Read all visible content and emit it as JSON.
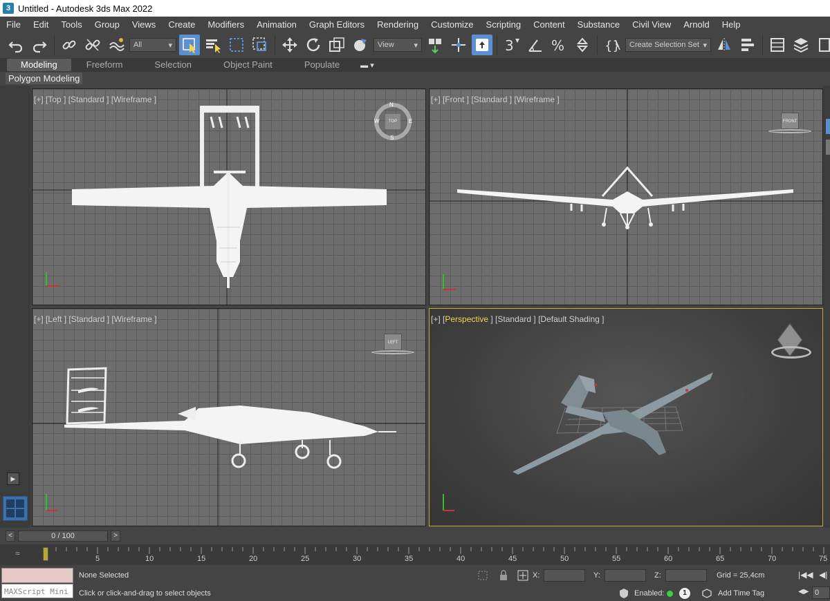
{
  "window": {
    "title": "Untitled - Autodesk 3ds Max 2022",
    "app_icon_text": "3"
  },
  "menu": [
    "File",
    "Edit",
    "Tools",
    "Group",
    "Views",
    "Create",
    "Modifiers",
    "Animation",
    "Graph Editors",
    "Rendering",
    "Customize",
    "Scripting",
    "Content",
    "Substance",
    "Civil View",
    "Arnold",
    "Help"
  ],
  "toolbar": {
    "filter_value": "All",
    "refcoord_value": "View",
    "selection_set_placeholder": "Create Selection Set",
    "snap_label": "3"
  },
  "ribbon": {
    "tabs": [
      "Modeling",
      "Freeform",
      "Selection",
      "Object Paint",
      "Populate"
    ],
    "active_tab": "Modeling",
    "panel_label": "Polygon Modeling"
  },
  "viewports": {
    "top": {
      "label": "[+] [Top ] [Standard ] [Wireframe ]",
      "compass": {
        "n": "N",
        "s": "S",
        "e": "E",
        "w": "W",
        "cube": "TOP"
      }
    },
    "front": {
      "label": "[+] [Front ] [Standard ] [Wireframe ]",
      "cube": "FRONT"
    },
    "left": {
      "label": "[+] [Left ] [Standard ] [Wireframe ]",
      "cube": "LEFT"
    },
    "perspective": {
      "label_open": "[+] [",
      "label_view": "Perspective",
      "label_rest": " ] [Standard ] [Default Shading ]"
    }
  },
  "timeline": {
    "frame_display": "0 / 100",
    "prev": "<",
    "next": ">",
    "ticks": [
      "5",
      "10",
      "15",
      "20",
      "25",
      "30",
      "35",
      "40",
      "45",
      "50",
      "55",
      "60",
      "65",
      "70",
      "75"
    ],
    "current_frame": 0
  },
  "status": {
    "maxscript_label": "MAXScript Mini",
    "selection": "None Selected",
    "prompt": "Click or click-and-drag to select objects",
    "x_label": "X:",
    "y_label": "Y:",
    "z_label": "Z:",
    "x_value": "",
    "y_value": "",
    "z_value": "",
    "grid": "Grid = 25,4cm",
    "enabled_label": "Enabled:",
    "enabled_count": "1",
    "add_time_tag": "Add Time Tag",
    "frame_field": "0"
  },
  "colors": {
    "accent": "#5b8fcf",
    "viewport_grid": "#6d6d6d",
    "perspective_border": "#c7a93a",
    "status_green": "#3fcf3f"
  }
}
